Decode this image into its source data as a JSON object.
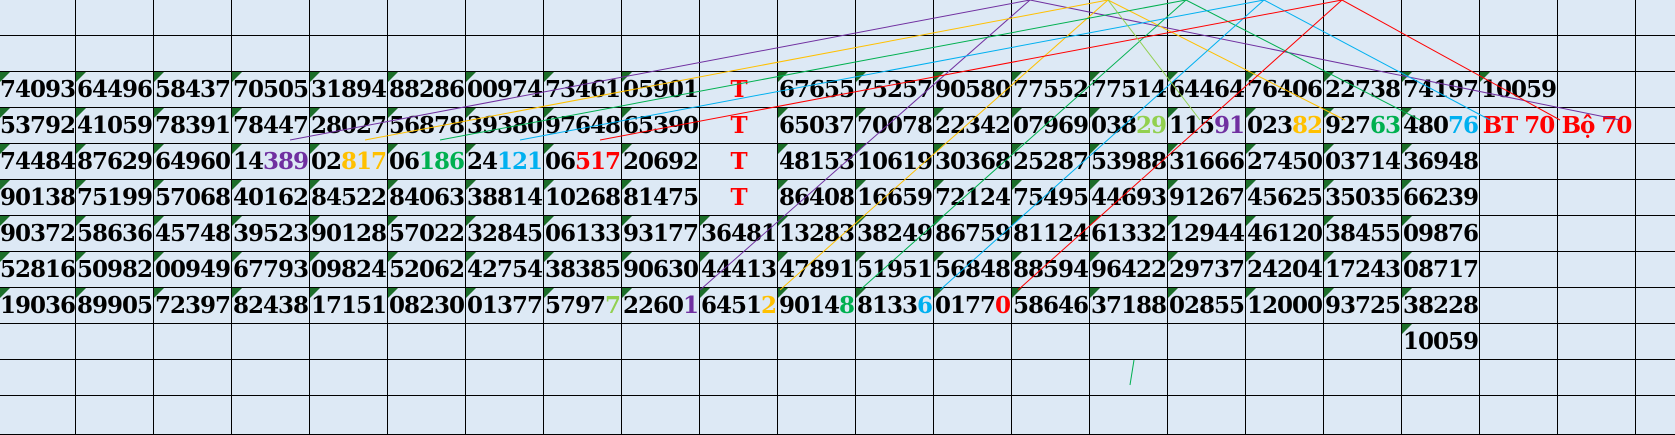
{
  "colors": {
    "purple": "#7030a0",
    "orange": "#ffc000",
    "green": "#00b050",
    "cyan": "#00b0f0",
    "red": "#ff0000",
    "lightgreen": "#92d050",
    "gridline": "#000000",
    "background": "#dde9f5",
    "corner_marker": "#1c6e2a"
  },
  "table": {
    "rows": [
      [],
      [],
      [
        {
          "t": "74093"
        },
        {
          "t": "64496"
        },
        {
          "t": "58437"
        },
        {
          "t": "70505"
        },
        {
          "t": "31894"
        },
        {
          "t": "88286"
        },
        {
          "t": "00974"
        },
        {
          "t": "73461"
        },
        {
          "t": "05901"
        },
        {
          "t": "T",
          "c": "red"
        },
        {
          "t": "67655"
        },
        {
          "t": "75257"
        },
        {
          "t": "90580"
        },
        {
          "t": "77552"
        },
        {
          "t": "77514"
        },
        {
          "t": "64464"
        },
        {
          "t": "76406"
        },
        {
          "t": "22738"
        },
        {
          "t": "74197"
        },
        {
          "t": "10059"
        },
        {
          "t": ""
        },
        {
          "t": ""
        }
      ],
      [
        {
          "t": "53792"
        },
        {
          "t": "41059"
        },
        {
          "t": "78391"
        },
        {
          "t": "78447"
        },
        {
          "t": "28027"
        },
        {
          "t": "56878"
        },
        {
          "t": "39380"
        },
        {
          "t": "97648"
        },
        {
          "t": "65390"
        },
        {
          "t": "T",
          "c": "red"
        },
        {
          "t": "65037"
        },
        {
          "t": "70078"
        },
        {
          "t": "22342"
        },
        {
          "t": "07969"
        },
        {
          "t": "038",
          "h": "29",
          "hc": "lightgreen"
        },
        {
          "t": "115",
          "h": "91",
          "hc": "purple"
        },
        {
          "t": "023",
          "h": "82",
          "hc": "orange"
        },
        {
          "t": "927",
          "h": "63",
          "hc": "green"
        },
        {
          "t": "480",
          "h": "76",
          "hc": "cyan"
        },
        {
          "t": "BT 70",
          "c": "red"
        },
        {
          "t": "Bộ 70",
          "c": "red"
        },
        {
          "t": ""
        }
      ],
      [
        {
          "t": "74484"
        },
        {
          "t": "87629"
        },
        {
          "t": "64960"
        },
        {
          "t": "14",
          "h": "389",
          "hc": "purple"
        },
        {
          "t": "02",
          "h": "817",
          "hc": "orange"
        },
        {
          "t": "06",
          "h": "186",
          "hc": "green"
        },
        {
          "t": "24",
          "h": "121",
          "hc": "cyan"
        },
        {
          "t": "06",
          "h": "517",
          "hc": "red"
        },
        {
          "t": "20692"
        },
        {
          "t": "T",
          "c": "red"
        },
        {
          "t": "48153"
        },
        {
          "t": "10619"
        },
        {
          "t": "30368"
        },
        {
          "t": "25287"
        },
        {
          "t": "53988"
        },
        {
          "t": "31666"
        },
        {
          "t": "27450"
        },
        {
          "t": "03714"
        },
        {
          "t": "36948"
        },
        {
          "t": ""
        },
        {
          "t": ""
        },
        {
          "t": ""
        }
      ],
      [
        {
          "t": "90138"
        },
        {
          "t": "75199"
        },
        {
          "t": "57068"
        },
        {
          "t": "40162"
        },
        {
          "t": "84522"
        },
        {
          "t": "84063"
        },
        {
          "t": "38814"
        },
        {
          "t": "10268"
        },
        {
          "t": "81475"
        },
        {
          "t": "T",
          "c": "red"
        },
        {
          "t": "86408"
        },
        {
          "t": "16659"
        },
        {
          "t": "72124"
        },
        {
          "t": "75495"
        },
        {
          "t": "44693"
        },
        {
          "t": "91267"
        },
        {
          "t": "45625"
        },
        {
          "t": "35035"
        },
        {
          "t": "66239"
        },
        {
          "t": ""
        },
        {
          "t": ""
        },
        {
          "t": ""
        }
      ],
      [
        {
          "t": "90372"
        },
        {
          "t": "58636"
        },
        {
          "t": "45748"
        },
        {
          "t": "39523"
        },
        {
          "t": "90128"
        },
        {
          "t": "57022"
        },
        {
          "t": "32845"
        },
        {
          "t": "06133"
        },
        {
          "t": "93177"
        },
        {
          "t": "36481"
        },
        {
          "t": "13283"
        },
        {
          "t": "38249"
        },
        {
          "t": "86759"
        },
        {
          "t": "81124"
        },
        {
          "t": "61332"
        },
        {
          "t": "12944"
        },
        {
          "t": "46120"
        },
        {
          "t": "38455"
        },
        {
          "t": "09876"
        },
        {
          "t": ""
        },
        {
          "t": ""
        },
        {
          "t": ""
        }
      ],
      [
        {
          "t": "52816"
        },
        {
          "t": "50982"
        },
        {
          "t": "00949"
        },
        {
          "t": "67793"
        },
        {
          "t": "09824"
        },
        {
          "t": "52062"
        },
        {
          "t": "42754"
        },
        {
          "t": "38385"
        },
        {
          "t": "90630"
        },
        {
          "t": "44413"
        },
        {
          "t": "47891"
        },
        {
          "t": "51951"
        },
        {
          "t": "56848"
        },
        {
          "t": "88594"
        },
        {
          "t": "96422"
        },
        {
          "t": "29737"
        },
        {
          "t": "24204"
        },
        {
          "t": "17243"
        },
        {
          "t": "08717"
        },
        {
          "t": ""
        },
        {
          "t": ""
        },
        {
          "t": ""
        }
      ],
      [
        {
          "t": "19036"
        },
        {
          "t": "89905"
        },
        {
          "t": "72397"
        },
        {
          "t": "82438"
        },
        {
          "t": "17151"
        },
        {
          "t": "08230"
        },
        {
          "t": "01377"
        },
        {
          "t": "5797",
          "h": "7",
          "hc": "lightgreen"
        },
        {
          "t": "2260",
          "h": "1",
          "hc": "purple"
        },
        {
          "t": "6451",
          "h": "2",
          "hc": "orange"
        },
        {
          "t": "9014",
          "h": "8",
          "hc": "green"
        },
        {
          "t": "8133",
          "h": "6",
          "hc": "cyan"
        },
        {
          "t": "0177",
          "h": "0",
          "hc": "red"
        },
        {
          "t": "58646"
        },
        {
          "t": "37188"
        },
        {
          "t": "02855"
        },
        {
          "t": "12000"
        },
        {
          "t": "93725"
        },
        {
          "t": "38228"
        },
        {
          "t": ""
        },
        {
          "t": ""
        },
        {
          "t": ""
        }
      ],
      [
        {
          "t": ""
        },
        {
          "t": ""
        },
        {
          "t": ""
        },
        {
          "t": ""
        },
        {
          "t": ""
        },
        {
          "t": ""
        },
        {
          "t": ""
        },
        {
          "t": ""
        },
        {
          "t": ""
        },
        {
          "t": ""
        },
        {
          "t": ""
        },
        {
          "t": ""
        },
        {
          "t": ""
        },
        {
          "t": ""
        },
        {
          "t": ""
        },
        {
          "t": ""
        },
        {
          "t": ""
        },
        {
          "t": ""
        },
        {
          "t": "10059"
        },
        {
          "t": ""
        },
        {
          "t": ""
        },
        {
          "t": ""
        }
      ],
      [],
      []
    ]
  }
}
